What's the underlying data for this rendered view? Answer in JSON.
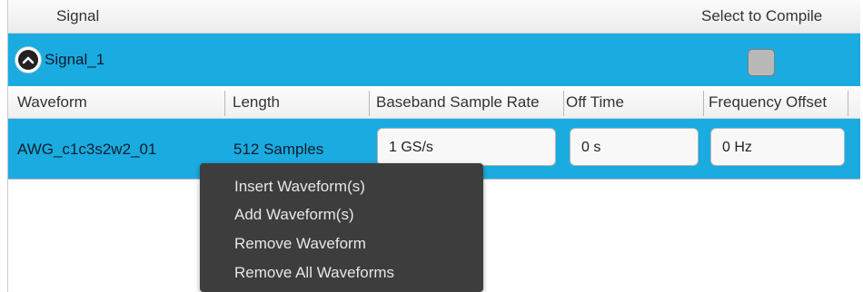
{
  "header": {
    "signal": "Signal",
    "select_to_compile": "Select to Compile"
  },
  "signal_row": {
    "name": "Signal_1",
    "compile_checked": false
  },
  "columns": {
    "waveform": "Waveform",
    "length": "Length",
    "baseband_sample_rate": "Baseband Sample Rate",
    "off_time": "Off Time",
    "frequency_offset": "Frequency Offset"
  },
  "waveform_row": {
    "name": "AWG_c1c3s2w2_01",
    "length": "512 Samples",
    "sample_rate": "1 GS/s",
    "off_time": "0 s",
    "frequency_offset": "0 Hz"
  },
  "context_menu": {
    "items": [
      "Insert Waveform(s)",
      "Add Waveform(s)",
      "Remove Waveform",
      "Remove All Waveforms"
    ]
  },
  "colors": {
    "selection": "#1aabe0",
    "menu_bg": "#3d3d3d",
    "menu_text": "#e6e6e6"
  },
  "icons": {
    "collapse": "chevron-up-icon"
  }
}
